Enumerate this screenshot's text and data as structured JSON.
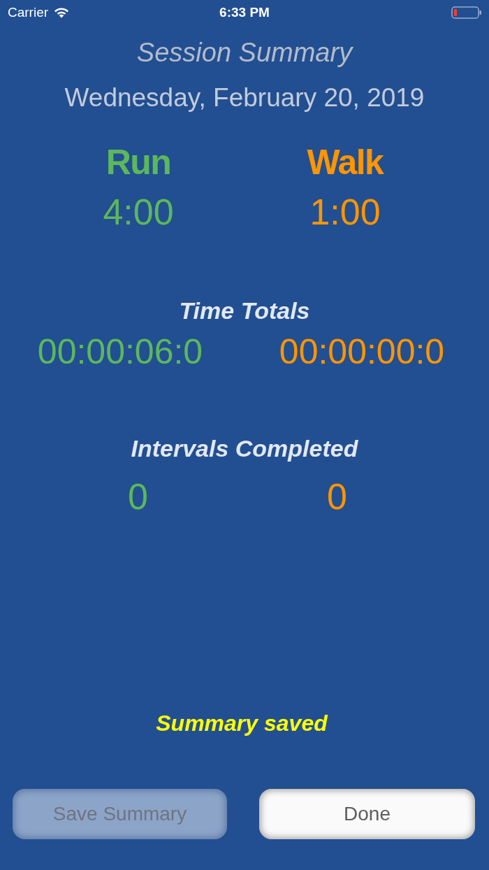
{
  "status_bar": {
    "carrier": "Carrier",
    "time": "6:33 PM"
  },
  "title": "Session Summary",
  "date": "Wednesday, February 20, 2019",
  "modes": [
    {
      "label": "Run",
      "duration": "4:00",
      "color": "#5cb85c"
    },
    {
      "label": "Walk",
      "duration": "1:00",
      "color": "#ff9500"
    }
  ],
  "time_totals": {
    "heading": "Time Totals",
    "values": [
      {
        "text": "00:00:06:0",
        "color": "#5cb85c"
      },
      {
        "text": "00:00:00:0",
        "color": "#ff9500"
      }
    ]
  },
  "intervals_completed": {
    "heading": "Intervals Completed",
    "values": [
      {
        "text": "0",
        "color": "#5cb85c"
      },
      {
        "text": "0",
        "color": "#ff9500"
      }
    ]
  },
  "status_message": "Summary saved",
  "buttons": [
    {
      "label": "Save Summary",
      "disabled": true
    },
    {
      "label": "Done",
      "disabled": false
    }
  ]
}
